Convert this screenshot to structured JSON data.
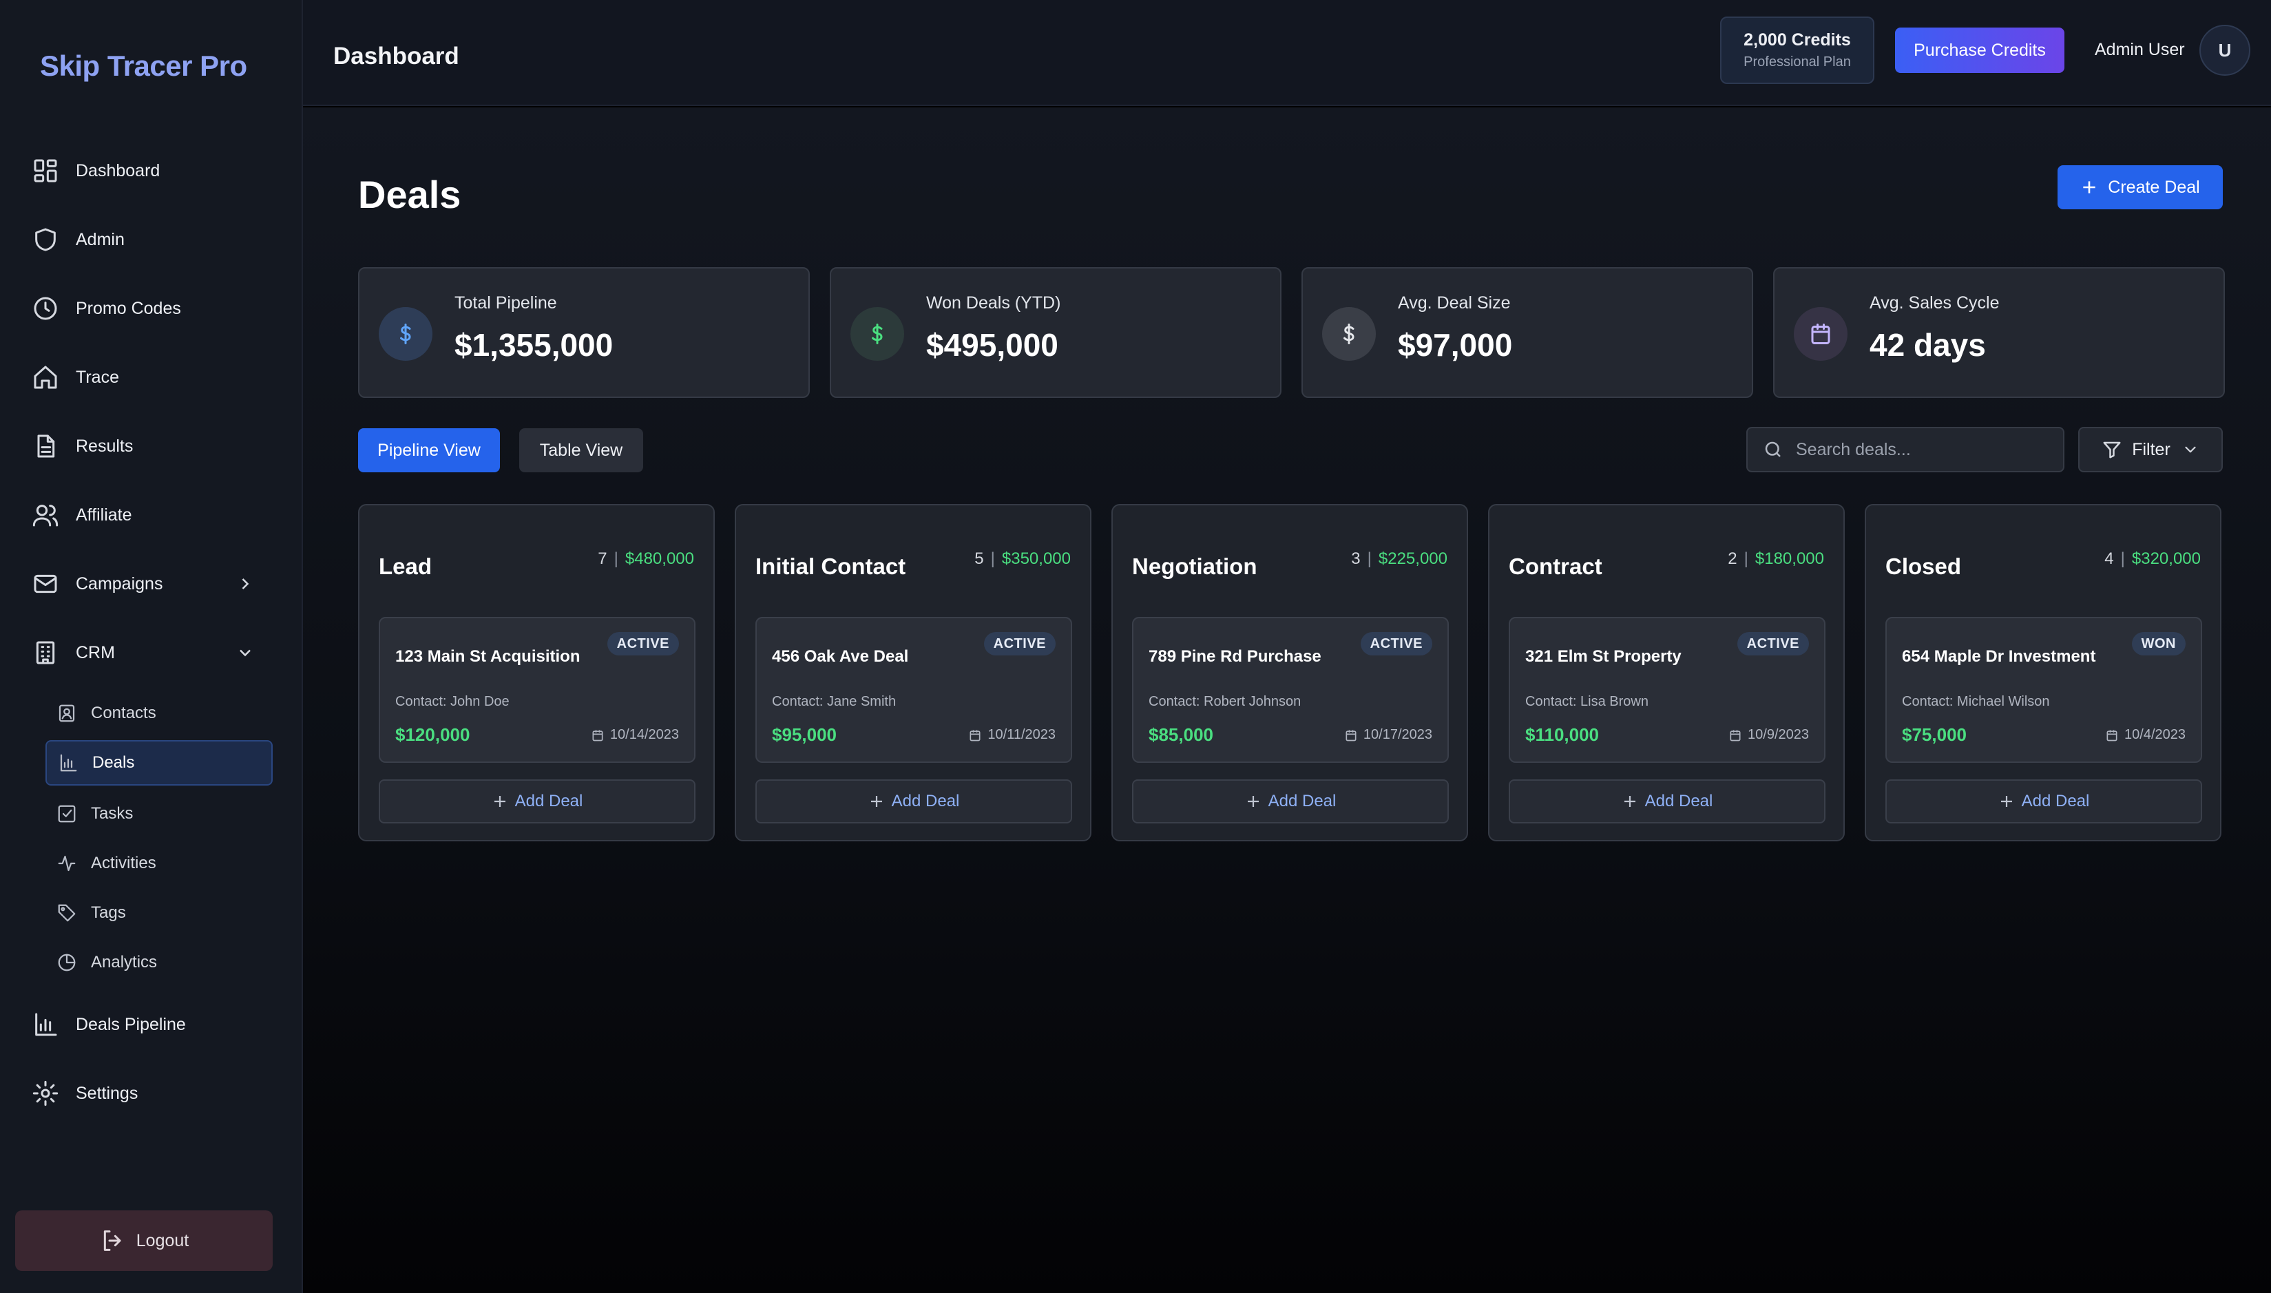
{
  "brand": "Skip Tracer Pro",
  "sidebar": {
    "items": [
      {
        "label": "Dashboard",
        "icon": "grid-icon"
      },
      {
        "label": "Admin",
        "icon": "shield-icon"
      },
      {
        "label": "Promo Codes",
        "icon": "clock-icon"
      },
      {
        "label": "Trace",
        "icon": "home-icon"
      },
      {
        "label": "Results",
        "icon": "document-icon"
      },
      {
        "label": "Affiliate",
        "icon": "users-icon"
      },
      {
        "label": "Campaigns",
        "icon": "mail-icon"
      },
      {
        "label": "CRM",
        "icon": "building-icon"
      }
    ],
    "crm_sub": [
      {
        "label": "Contacts",
        "icon": "contact-card-icon"
      },
      {
        "label": "Deals",
        "icon": "bar-chart-icon"
      },
      {
        "label": "Tasks",
        "icon": "checkbox-icon"
      },
      {
        "label": "Activities",
        "icon": "activity-icon"
      },
      {
        "label": "Tags",
        "icon": "tag-icon"
      },
      {
        "label": "Analytics",
        "icon": "pie-chart-icon"
      }
    ],
    "bottom_items": [
      {
        "label": "Deals Pipeline",
        "icon": "bar-chart-icon"
      },
      {
        "label": "Settings",
        "icon": "gear-icon"
      }
    ],
    "logout": "Logout"
  },
  "header": {
    "title": "Dashboard",
    "credits": "2,000 Credits",
    "plan": "Professional Plan",
    "purchase": "Purchase Credits",
    "user": "Admin User",
    "avatar": "U"
  },
  "page": {
    "title": "Deals",
    "create_button": "Create Deal"
  },
  "stats": [
    {
      "label": "Total Pipeline",
      "value": "$1,355,000",
      "icon": "dollar-icon",
      "color": "#60a5fa"
    },
    {
      "label": "Won Deals (YTD)",
      "value": "$495,000",
      "icon": "dollar-icon",
      "color": "#4ade80"
    },
    {
      "label": "Avg. Deal Size",
      "value": "$97,000",
      "icon": "dollar-icon",
      "color": "#e5e7eb"
    },
    {
      "label": "Avg. Sales Cycle",
      "value": "42 days",
      "icon": "calendar-icon",
      "color": "#c4b5fd"
    }
  ],
  "views": {
    "pipeline": "Pipeline View",
    "table": "Table View"
  },
  "search": {
    "placeholder": "Search deals..."
  },
  "filter": "Filter",
  "columns": [
    {
      "title": "Lead",
      "count": "7",
      "amount": "$480,000",
      "deal": {
        "name": "123 Main St Acquisition",
        "status": "ACTIVE",
        "contact": "Contact: John Doe",
        "value": "$120,000",
        "date": "10/14/2023"
      },
      "add": "Add Deal"
    },
    {
      "title": "Initial Contact",
      "count": "5",
      "amount": "$350,000",
      "deal": {
        "name": "456 Oak Ave Deal",
        "status": "ACTIVE",
        "contact": "Contact: Jane Smith",
        "value": "$95,000",
        "date": "10/11/2023"
      },
      "add": "Add Deal"
    },
    {
      "title": "Negotiation",
      "count": "3",
      "amount": "$225,000",
      "deal": {
        "name": "789 Pine Rd Purchase",
        "status": "ACTIVE",
        "contact": "Contact: Robert Johnson",
        "value": "$85,000",
        "date": "10/17/2023"
      },
      "add": "Add Deal"
    },
    {
      "title": "Contract",
      "count": "2",
      "amount": "$180,000",
      "deal": {
        "name": "321 Elm St Property",
        "status": "ACTIVE",
        "contact": "Contact: Lisa Brown",
        "value": "$110,000",
        "date": "10/9/2023"
      },
      "add": "Add Deal"
    },
    {
      "title": "Closed",
      "count": "4",
      "amount": "$320,000",
      "deal": {
        "name": "654 Maple Dr Investment",
        "status": "WON",
        "contact": "Contact: Michael Wilson",
        "value": "$75,000",
        "date": "10/4/2023"
      },
      "add": "Add Deal"
    }
  ]
}
